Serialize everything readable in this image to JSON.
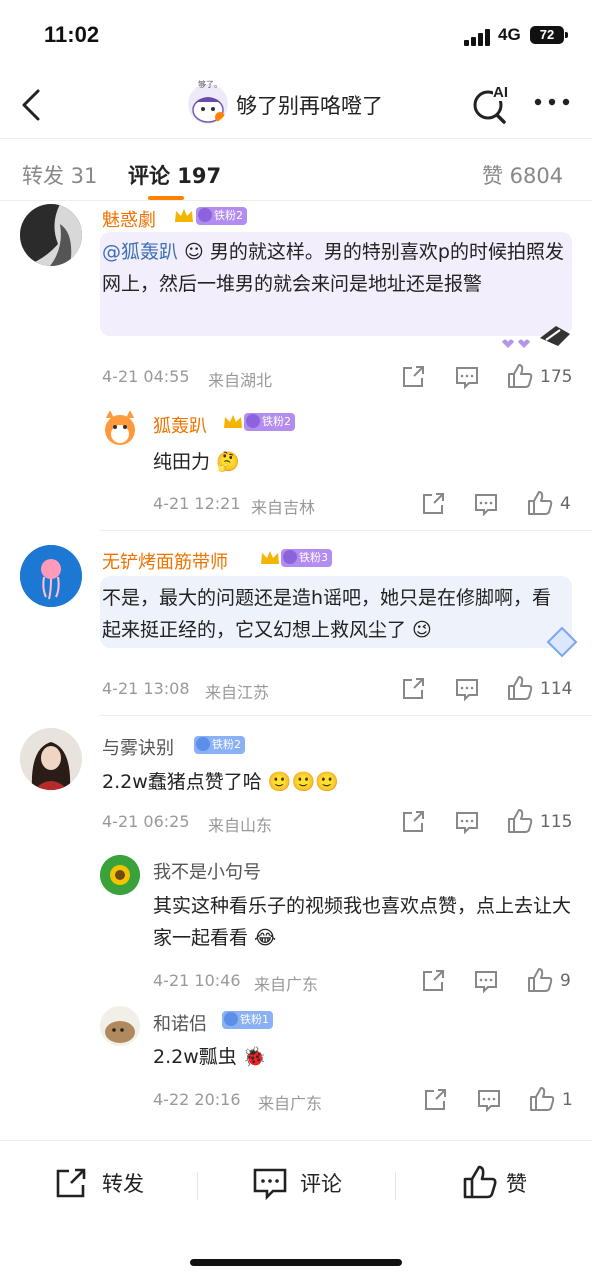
{
  "status_bar": {
    "time": "11:02",
    "network": "4G",
    "battery": "72"
  },
  "header": {
    "title": "够了别再咯噔了",
    "avatar_caption": "够了。",
    "ai_label": "AI"
  },
  "tabs": {
    "repost": "转发 31",
    "comments": "评论 197",
    "likes": "赞 6804"
  },
  "comments": [
    {
      "user": "魅惑劇",
      "badge": "铁粉2",
      "mention": "@狐轰趴",
      "text_after_mention": "男的就这样。男的特别喜欢p的时候拍照发网上，然后一堆男的就会来问是地址还是报警",
      "time": "4-21 04:55",
      "location": "来自湖北",
      "likes": "175",
      "replies": [
        {
          "user": "狐轰趴",
          "badge": "铁粉2",
          "text": "纯田力",
          "time": "4-21 12:21",
          "location": "来自吉林",
          "likes": "4"
        }
      ]
    },
    {
      "user": "无铲烤面筋带师",
      "badge": "铁粉3",
      "text": "不是，最大的问题还是造h谣吧，她只是在修脚啊，看起来挺正经的，它又幻想上救风尘了",
      "time": "4-21 13:08",
      "location": "来自江苏",
      "likes": "114"
    },
    {
      "user": "与雾诀别",
      "badge": "铁粉2",
      "text": "2.2w蠢猪点赞了哈",
      "time": "4-21 06:25",
      "location": "来自山东",
      "likes": "115",
      "replies": [
        {
          "user": "我不是小句号",
          "text": "其实这种看乐子的视频我也喜欢点赞，点上去让大家一起看看",
          "time": "4-21 10:46",
          "location": "来自广东",
          "likes": "9"
        },
        {
          "user": "和诺侣",
          "badge": "铁粉1",
          "text": "2.2w瓢虫",
          "time": "4-22 20:16",
          "location": "来自广东",
          "likes": "1"
        }
      ]
    }
  ],
  "bottom_bar": {
    "repost": "转发",
    "comment": "评论",
    "like": "赞"
  }
}
